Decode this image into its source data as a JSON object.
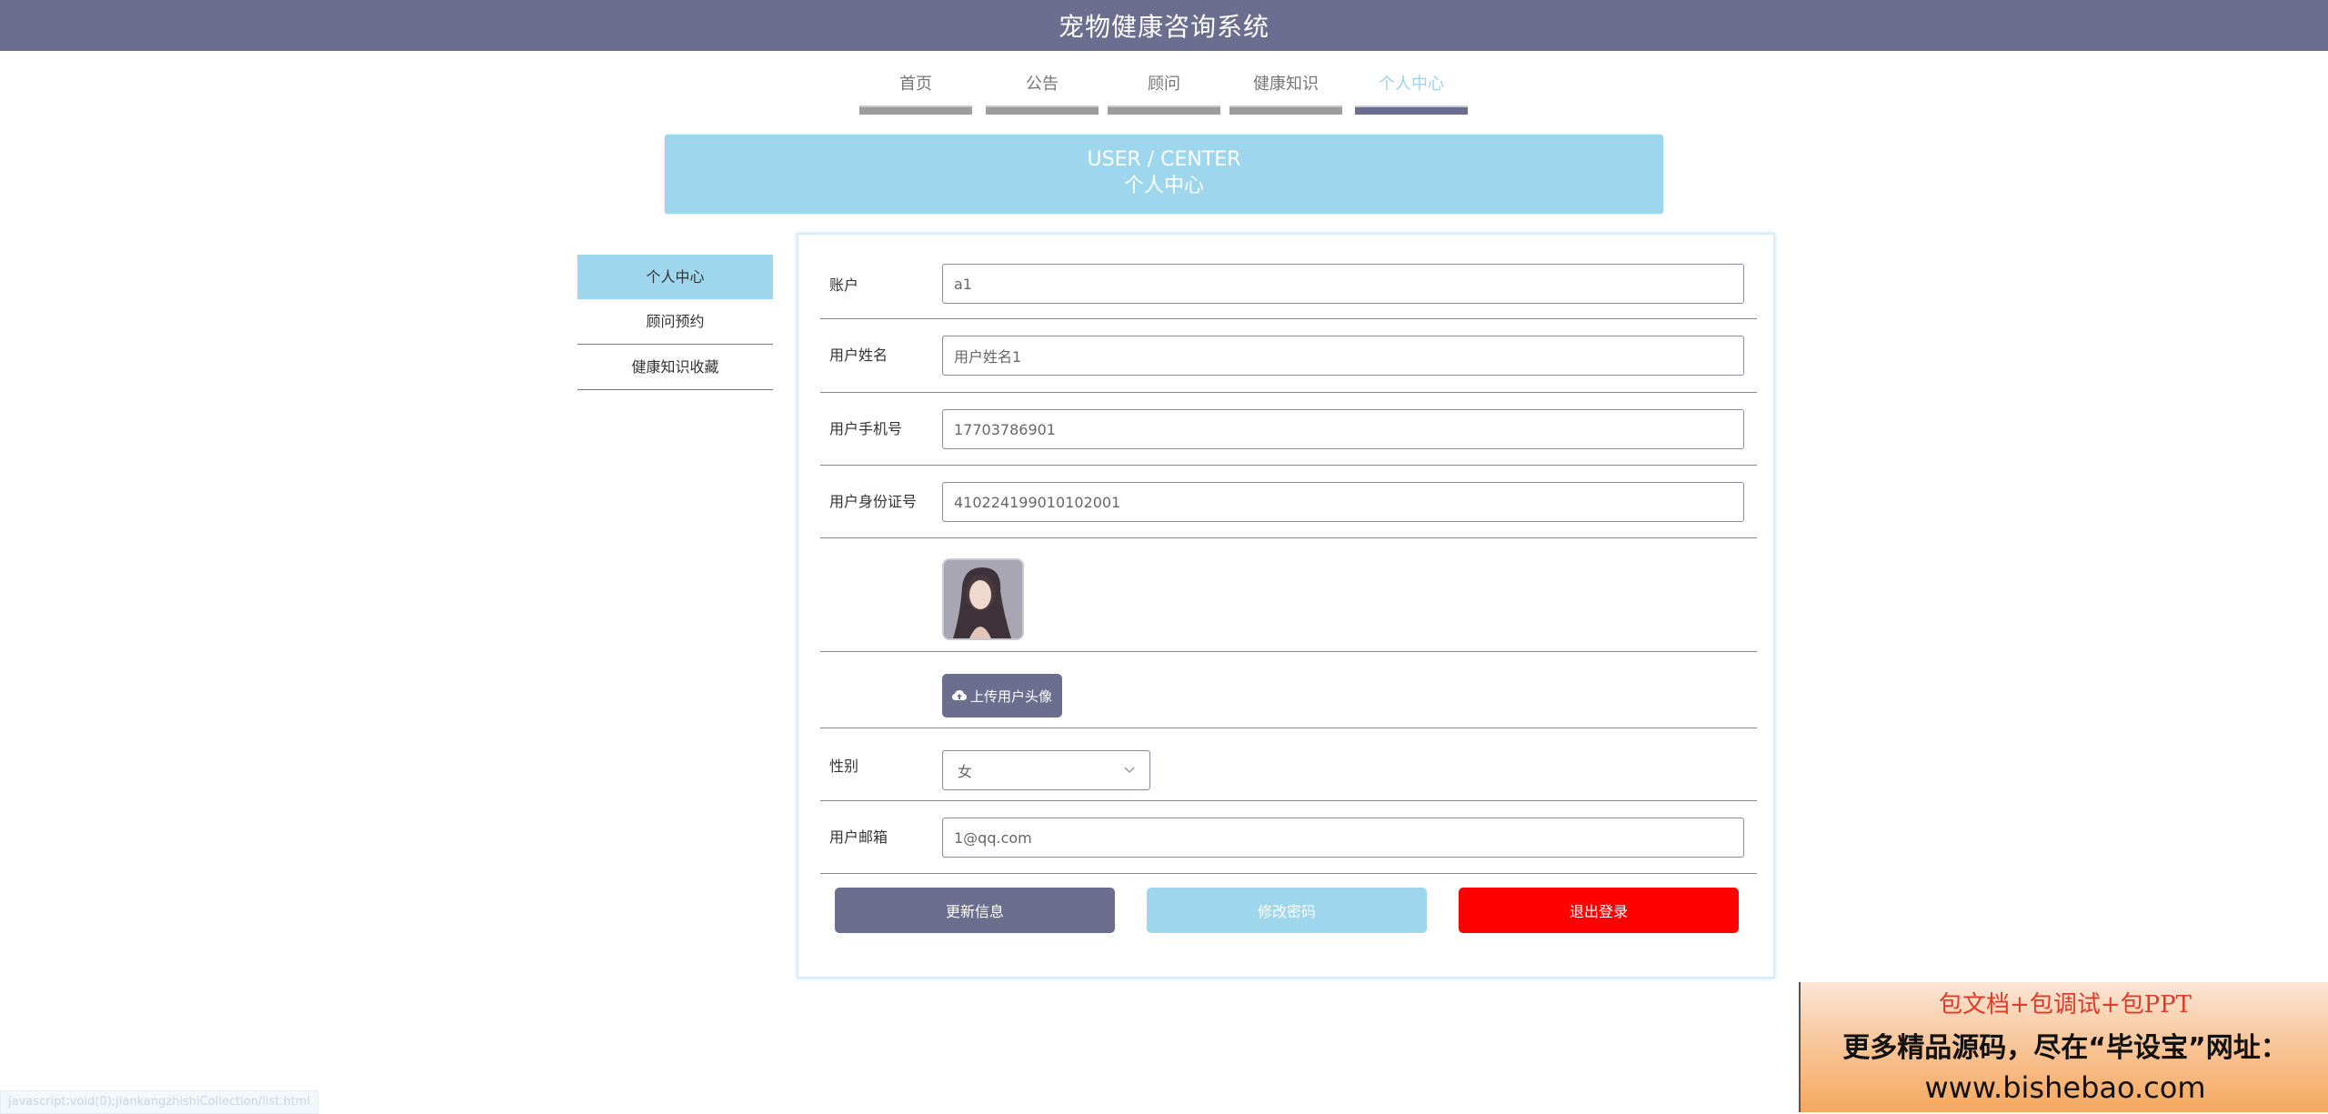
{
  "header": {
    "title": "宠物健康咨询系统"
  },
  "nav": [
    {
      "label": "首页"
    },
    {
      "label": "公告"
    },
    {
      "label": "顾问"
    },
    {
      "label": "健康知识"
    },
    {
      "label": "个人中心"
    }
  ],
  "banner": {
    "en": "USER / CENTER",
    "cn": "个人中心"
  },
  "sidebar": [
    {
      "label": "个人中心"
    },
    {
      "label": "顾问预约"
    },
    {
      "label": "健康知识收藏"
    }
  ],
  "form": {
    "account": {
      "label": "账户",
      "value": "a1"
    },
    "name": {
      "label": "用户姓名",
      "value": "用户姓名1"
    },
    "phone": {
      "label": "用户手机号",
      "value": "17703786901"
    },
    "idcard": {
      "label": "用户身份证号",
      "value": "410224199010102001"
    },
    "upload_label": "上传用户头像",
    "gender": {
      "label": "性别",
      "value": "女"
    },
    "email": {
      "label": "用户邮箱",
      "value": "1@qq.com"
    }
  },
  "buttons": {
    "update": "更新信息",
    "password": "修改密码",
    "logout": "退出登录"
  },
  "colors": {
    "primary": "#6b6e8f",
    "accent": "#9dd6ed",
    "danger": "#ff0000"
  },
  "ad": {
    "line1": "包文档+包调试+包PPT",
    "line2": "更多精品源码，尽在“毕设宝”网址：",
    "line3": "www.bishebao.com"
  },
  "status_url": "javascript:void(0);jiankangzhishiCollection/list.html"
}
